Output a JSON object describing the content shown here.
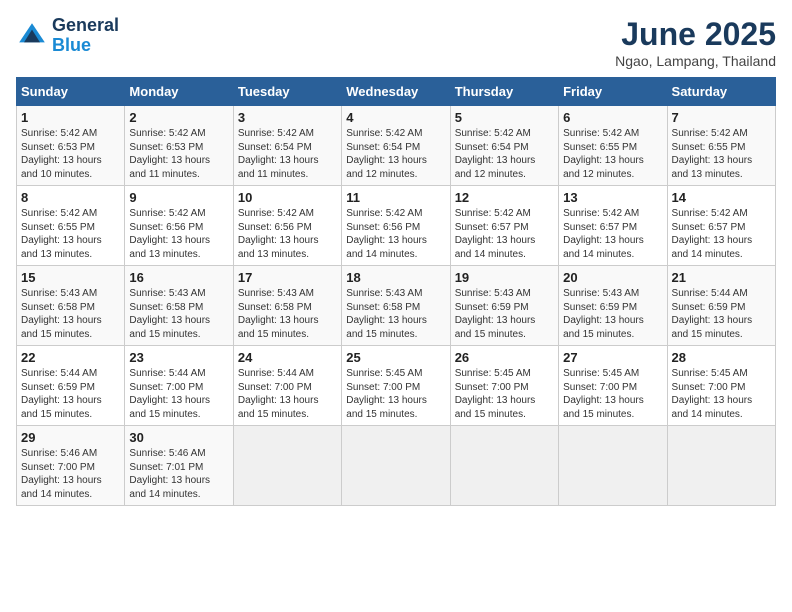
{
  "logo": {
    "line1": "General",
    "line2": "Blue"
  },
  "title": "June 2025",
  "subtitle": "Ngao, Lampang, Thailand",
  "weekdays": [
    "Sunday",
    "Monday",
    "Tuesday",
    "Wednesday",
    "Thursday",
    "Friday",
    "Saturday"
  ],
  "weeks": [
    [
      {
        "day": "1",
        "sunrise": "Sunrise: 5:42 AM",
        "sunset": "Sunset: 6:53 PM",
        "daylight": "Daylight: 13 hours and 10 minutes."
      },
      {
        "day": "2",
        "sunrise": "Sunrise: 5:42 AM",
        "sunset": "Sunset: 6:53 PM",
        "daylight": "Daylight: 13 hours and 11 minutes."
      },
      {
        "day": "3",
        "sunrise": "Sunrise: 5:42 AM",
        "sunset": "Sunset: 6:54 PM",
        "daylight": "Daylight: 13 hours and 11 minutes."
      },
      {
        "day": "4",
        "sunrise": "Sunrise: 5:42 AM",
        "sunset": "Sunset: 6:54 PM",
        "daylight": "Daylight: 13 hours and 12 minutes."
      },
      {
        "day": "5",
        "sunrise": "Sunrise: 5:42 AM",
        "sunset": "Sunset: 6:54 PM",
        "daylight": "Daylight: 13 hours and 12 minutes."
      },
      {
        "day": "6",
        "sunrise": "Sunrise: 5:42 AM",
        "sunset": "Sunset: 6:55 PM",
        "daylight": "Daylight: 13 hours and 12 minutes."
      },
      {
        "day": "7",
        "sunrise": "Sunrise: 5:42 AM",
        "sunset": "Sunset: 6:55 PM",
        "daylight": "Daylight: 13 hours and 13 minutes."
      }
    ],
    [
      {
        "day": "8",
        "sunrise": "Sunrise: 5:42 AM",
        "sunset": "Sunset: 6:55 PM",
        "daylight": "Daylight: 13 hours and 13 minutes."
      },
      {
        "day": "9",
        "sunrise": "Sunrise: 5:42 AM",
        "sunset": "Sunset: 6:56 PM",
        "daylight": "Daylight: 13 hours and 13 minutes."
      },
      {
        "day": "10",
        "sunrise": "Sunrise: 5:42 AM",
        "sunset": "Sunset: 6:56 PM",
        "daylight": "Daylight: 13 hours and 13 minutes."
      },
      {
        "day": "11",
        "sunrise": "Sunrise: 5:42 AM",
        "sunset": "Sunset: 6:56 PM",
        "daylight": "Daylight: 13 hours and 14 minutes."
      },
      {
        "day": "12",
        "sunrise": "Sunrise: 5:42 AM",
        "sunset": "Sunset: 6:57 PM",
        "daylight": "Daylight: 13 hours and 14 minutes."
      },
      {
        "day": "13",
        "sunrise": "Sunrise: 5:42 AM",
        "sunset": "Sunset: 6:57 PM",
        "daylight": "Daylight: 13 hours and 14 minutes."
      },
      {
        "day": "14",
        "sunrise": "Sunrise: 5:42 AM",
        "sunset": "Sunset: 6:57 PM",
        "daylight": "Daylight: 13 hours and 14 minutes."
      }
    ],
    [
      {
        "day": "15",
        "sunrise": "Sunrise: 5:43 AM",
        "sunset": "Sunset: 6:58 PM",
        "daylight": "Daylight: 13 hours and 15 minutes."
      },
      {
        "day": "16",
        "sunrise": "Sunrise: 5:43 AM",
        "sunset": "Sunset: 6:58 PM",
        "daylight": "Daylight: 13 hours and 15 minutes."
      },
      {
        "day": "17",
        "sunrise": "Sunrise: 5:43 AM",
        "sunset": "Sunset: 6:58 PM",
        "daylight": "Daylight: 13 hours and 15 minutes."
      },
      {
        "day": "18",
        "sunrise": "Sunrise: 5:43 AM",
        "sunset": "Sunset: 6:58 PM",
        "daylight": "Daylight: 13 hours and 15 minutes."
      },
      {
        "day": "19",
        "sunrise": "Sunrise: 5:43 AM",
        "sunset": "Sunset: 6:59 PM",
        "daylight": "Daylight: 13 hours and 15 minutes."
      },
      {
        "day": "20",
        "sunrise": "Sunrise: 5:43 AM",
        "sunset": "Sunset: 6:59 PM",
        "daylight": "Daylight: 13 hours and 15 minutes."
      },
      {
        "day": "21",
        "sunrise": "Sunrise: 5:44 AM",
        "sunset": "Sunset: 6:59 PM",
        "daylight": "Daylight: 13 hours and 15 minutes."
      }
    ],
    [
      {
        "day": "22",
        "sunrise": "Sunrise: 5:44 AM",
        "sunset": "Sunset: 6:59 PM",
        "daylight": "Daylight: 13 hours and 15 minutes."
      },
      {
        "day": "23",
        "sunrise": "Sunrise: 5:44 AM",
        "sunset": "Sunset: 7:00 PM",
        "daylight": "Daylight: 13 hours and 15 minutes."
      },
      {
        "day": "24",
        "sunrise": "Sunrise: 5:44 AM",
        "sunset": "Sunset: 7:00 PM",
        "daylight": "Daylight: 13 hours and 15 minutes."
      },
      {
        "day": "25",
        "sunrise": "Sunrise: 5:45 AM",
        "sunset": "Sunset: 7:00 PM",
        "daylight": "Daylight: 13 hours and 15 minutes."
      },
      {
        "day": "26",
        "sunrise": "Sunrise: 5:45 AM",
        "sunset": "Sunset: 7:00 PM",
        "daylight": "Daylight: 13 hours and 15 minutes."
      },
      {
        "day": "27",
        "sunrise": "Sunrise: 5:45 AM",
        "sunset": "Sunset: 7:00 PM",
        "daylight": "Daylight: 13 hours and 15 minutes."
      },
      {
        "day": "28",
        "sunrise": "Sunrise: 5:45 AM",
        "sunset": "Sunset: 7:00 PM",
        "daylight": "Daylight: 13 hours and 14 minutes."
      }
    ],
    [
      {
        "day": "29",
        "sunrise": "Sunrise: 5:46 AM",
        "sunset": "Sunset: 7:00 PM",
        "daylight": "Daylight: 13 hours and 14 minutes."
      },
      {
        "day": "30",
        "sunrise": "Sunrise: 5:46 AM",
        "sunset": "Sunset: 7:01 PM",
        "daylight": "Daylight: 13 hours and 14 minutes."
      },
      null,
      null,
      null,
      null,
      null
    ]
  ]
}
